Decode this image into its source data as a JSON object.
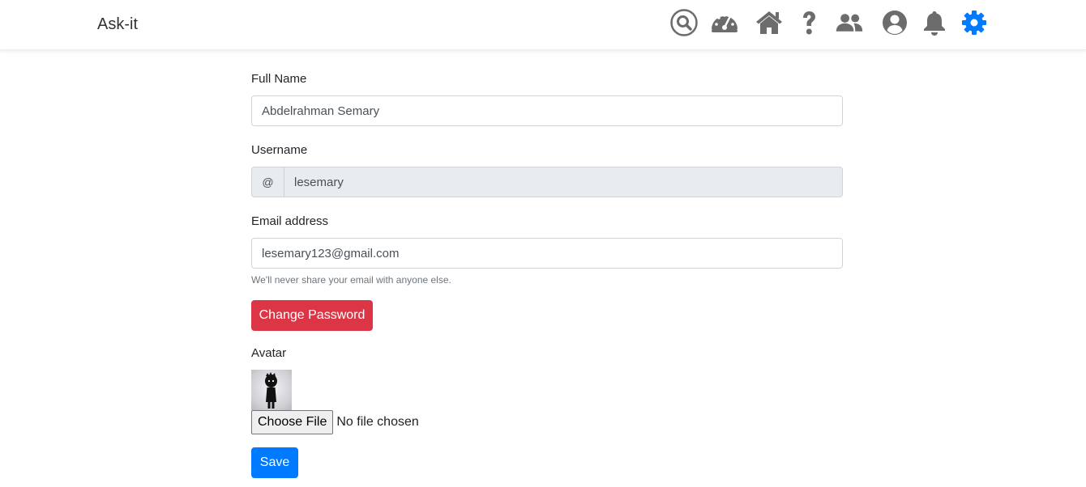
{
  "app": {
    "brand": "Ask-it"
  },
  "nav": {
    "icons": [
      "search-icon",
      "dashboard-icon",
      "home-icon",
      "help-icon",
      "users-icon",
      "profile-icon",
      "bell-icon",
      "gear-icon"
    ],
    "active": "gear-icon",
    "icon_color": "#6c6c6c",
    "active_color": "#007bff"
  },
  "form": {
    "full_name": {
      "label": "Full Name",
      "value": "Abdelrahman Semary"
    },
    "username": {
      "label": "Username",
      "prefix": "@",
      "value": "lesemary"
    },
    "email": {
      "label": "Email address",
      "value": "lesemary123@gmail.com",
      "help": "We'll never share your email with anyone else."
    },
    "change_password": {
      "label": "Change Password",
      "color": "#dc3545"
    },
    "avatar": {
      "label": "Avatar",
      "choose_file": "Choose File",
      "file_status": "No file chosen"
    },
    "save": {
      "label": "Save",
      "color": "#007bff"
    }
  }
}
